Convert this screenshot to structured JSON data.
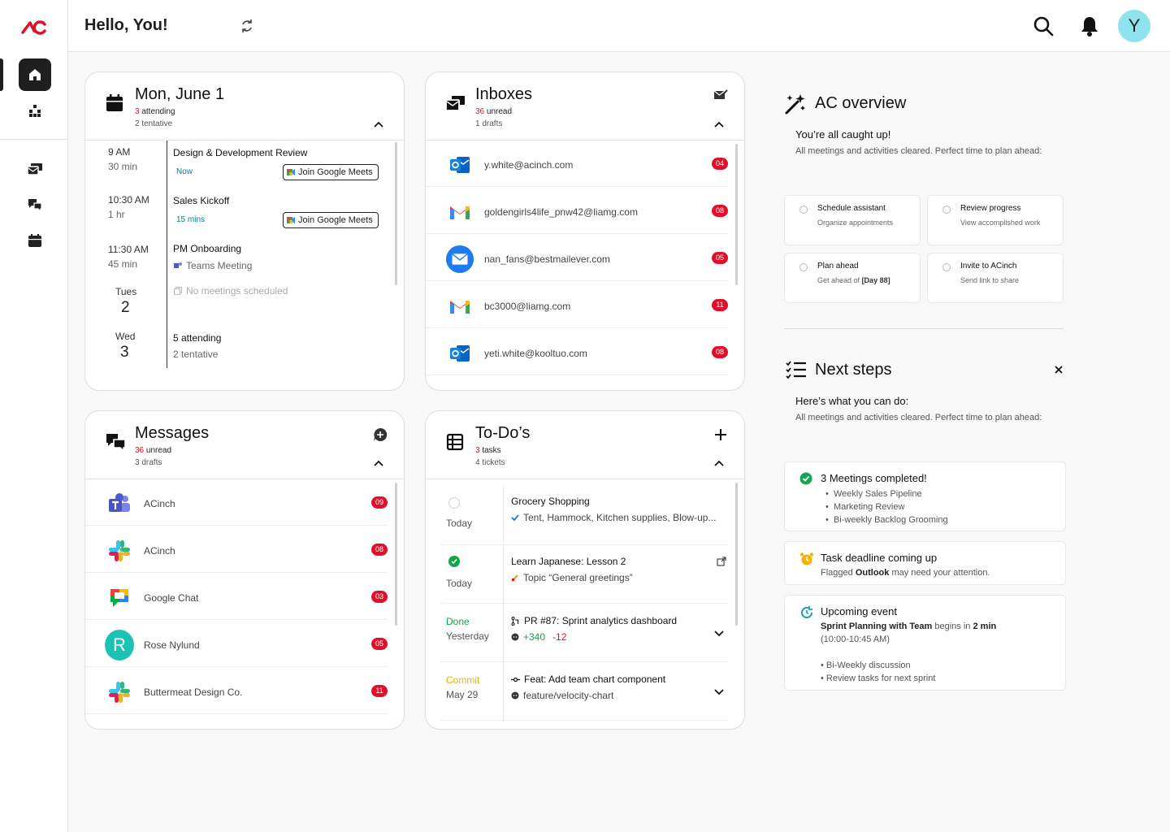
{
  "app": {
    "logo_text": "ac",
    "greeting": "Hello, You!",
    "avatar_letter": "Y"
  },
  "sidebar": {
    "items": [
      "home-icon",
      "org-chart-icon",
      "inbox-icon",
      "messages-icon",
      "calendar-icon"
    ]
  },
  "calendar": {
    "title": "Mon, June 1",
    "attending_count": "3",
    "attending_label": "attending",
    "tentative": "2 tentative",
    "events": [
      {
        "time": "9 AM",
        "duration": "30 min",
        "title": "Design & Development Review",
        "status": "Now",
        "action": "Join Google Meets"
      },
      {
        "time": "10:30 AM",
        "duration": "1 hr",
        "title": "Sales Kickoff",
        "status": "15 mins",
        "action": "Join Google Meets"
      },
      {
        "time": "11:30 AM",
        "duration": "45 min",
        "title": "PM Onboarding",
        "platform": "Teams Meeting"
      }
    ],
    "days": [
      {
        "day": "Tues",
        "num": "2",
        "line1": "No meetings scheduled"
      },
      {
        "day": "Wed",
        "num": "3",
        "line1": "5 attending",
        "line2": "2 tentative"
      }
    ]
  },
  "inboxes": {
    "title": "Inboxes",
    "unread_count": "36",
    "unread_label": "unread",
    "drafts": "1 drafts",
    "accounts": [
      {
        "email": "y.white@acinch.com",
        "badge": "04",
        "provider": "outlook"
      },
      {
        "email": "goldengirls4life_pnw42@liamg.com",
        "badge": "08",
        "provider": "gmail"
      },
      {
        "email": "nan_fans@bestmailever.com",
        "badge": "05",
        "provider": "mail"
      },
      {
        "email": "bc3000@liamg.com",
        "badge": "11",
        "provider": "gmail"
      },
      {
        "email": "yeti.white@kooltuo.com",
        "badge": "08",
        "provider": "outlook"
      }
    ]
  },
  "messages": {
    "title": "Messages",
    "unread_count": "36",
    "unread_label": "unread",
    "drafts": "3 drafts",
    "channels": [
      {
        "name": "ACinch",
        "badge": "09",
        "app": "teams"
      },
      {
        "name": "ACinch",
        "badge": "08",
        "app": "slack"
      },
      {
        "name": "Google Chat",
        "badge": "03",
        "app": "google-chat"
      },
      {
        "name": "Rose Nylund",
        "badge": "05",
        "app": "avatar",
        "initial": "R"
      },
      {
        "name": "Buttermeat Design Co.",
        "badge": "11",
        "app": "slack"
      }
    ]
  },
  "todos": {
    "title": "To-Do’s",
    "tasks_count": "3",
    "tasks_label": "tasks",
    "tickets": "4 tickets",
    "items": [
      {
        "status": "",
        "date": "Today",
        "title": "Grocery Shopping",
        "sub": "Tent, Hammock, Kitchen supplies, Blow-up..."
      },
      {
        "status": "",
        "date": "Today",
        "title": "Learn Japanese: Lesson 2",
        "sub": "Topic “General greetings”"
      },
      {
        "status": "Done",
        "date": "Yesterday",
        "title": "PR #87: Sprint analytics dashboard",
        "add": "+340",
        "del": "-12"
      },
      {
        "status": "Commit",
        "date": "May 29",
        "title": "Feat: Add team chart component",
        "sub": "feature/velocity-chart"
      }
    ]
  },
  "overview": {
    "title": "AC overview",
    "subtitle": "You’re all caught up!",
    "desc": "All meetings and activities cleared. Perfect time to plan ahead:",
    "tiles": [
      {
        "title": "Schedule assistant",
        "sub": "Organize appointments"
      },
      {
        "title": "Review progress",
        "sub": "View accomplished work"
      },
      {
        "title": "Plan ahead",
        "sub": "Get ahead of",
        "sub_bold": "[Day 88]"
      },
      {
        "title": "Invite to ACinch",
        "sub": "Send link to share"
      }
    ]
  },
  "next_steps": {
    "title": "Next steps",
    "subtitle": "Here’s what you can do:",
    "desc": "All meetings and activities cleared. Perfect time to plan ahead:",
    "meetings": {
      "title": "3 Meetings completed!",
      "items": [
        "Weekly Sales Pipeline",
        "Marketing Review",
        "Bi-weekly Backlog Grooming"
      ]
    },
    "deadline": {
      "title": "Task deadline coming up",
      "pre": "Flagged",
      "bold": "Outlook",
      "post": "may need your attention."
    },
    "upcoming": {
      "title": "Upcoming event",
      "event": "Sprint Planning with Team",
      "begins": "begins in",
      "when": "2 min",
      "range": "(10:00-10:45 AM)",
      "items": [
        "Bi-Weekly discussion",
        "Review tasks for next sprint"
      ]
    }
  },
  "colors": {
    "accent_red": "#e0102a",
    "teal": "#127a84",
    "avatar_bg": "#8fe3ec",
    "done_green": "#16a34a",
    "commit_yellow": "#e0b800"
  }
}
